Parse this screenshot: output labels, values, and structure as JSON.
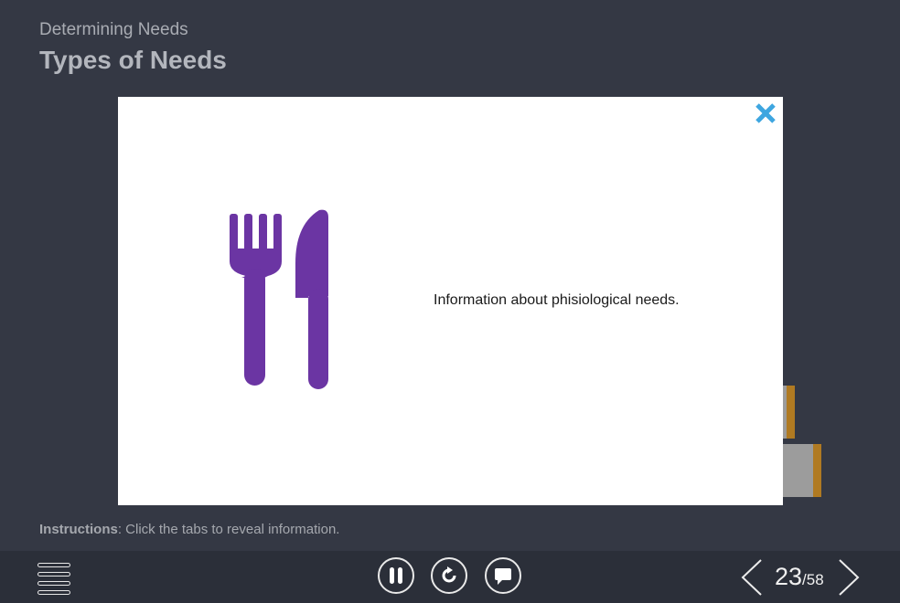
{
  "slide": {
    "subtitle": "Determining Needs",
    "title": "Types of Needs",
    "instructions_label": "Instructions",
    "instructions_text": ": Click the tabs to reveal information."
  },
  "modal": {
    "text": "Information about phisiological needs.",
    "icon": "fork-knife-icon",
    "icon_color": "#6b35a3",
    "close_color": "#3ea6e0"
  },
  "player": {
    "page_current": "23",
    "page_separator": "/",
    "page_total": "58",
    "buttons": [
      "menu-icon",
      "pause-icon",
      "replay-icon",
      "chat-icon",
      "prev-arrow-icon",
      "next-arrow-icon"
    ]
  },
  "colors": {
    "background": "#343844",
    "bar": "#2b2f39",
    "tab_edge": "#b07a22"
  }
}
